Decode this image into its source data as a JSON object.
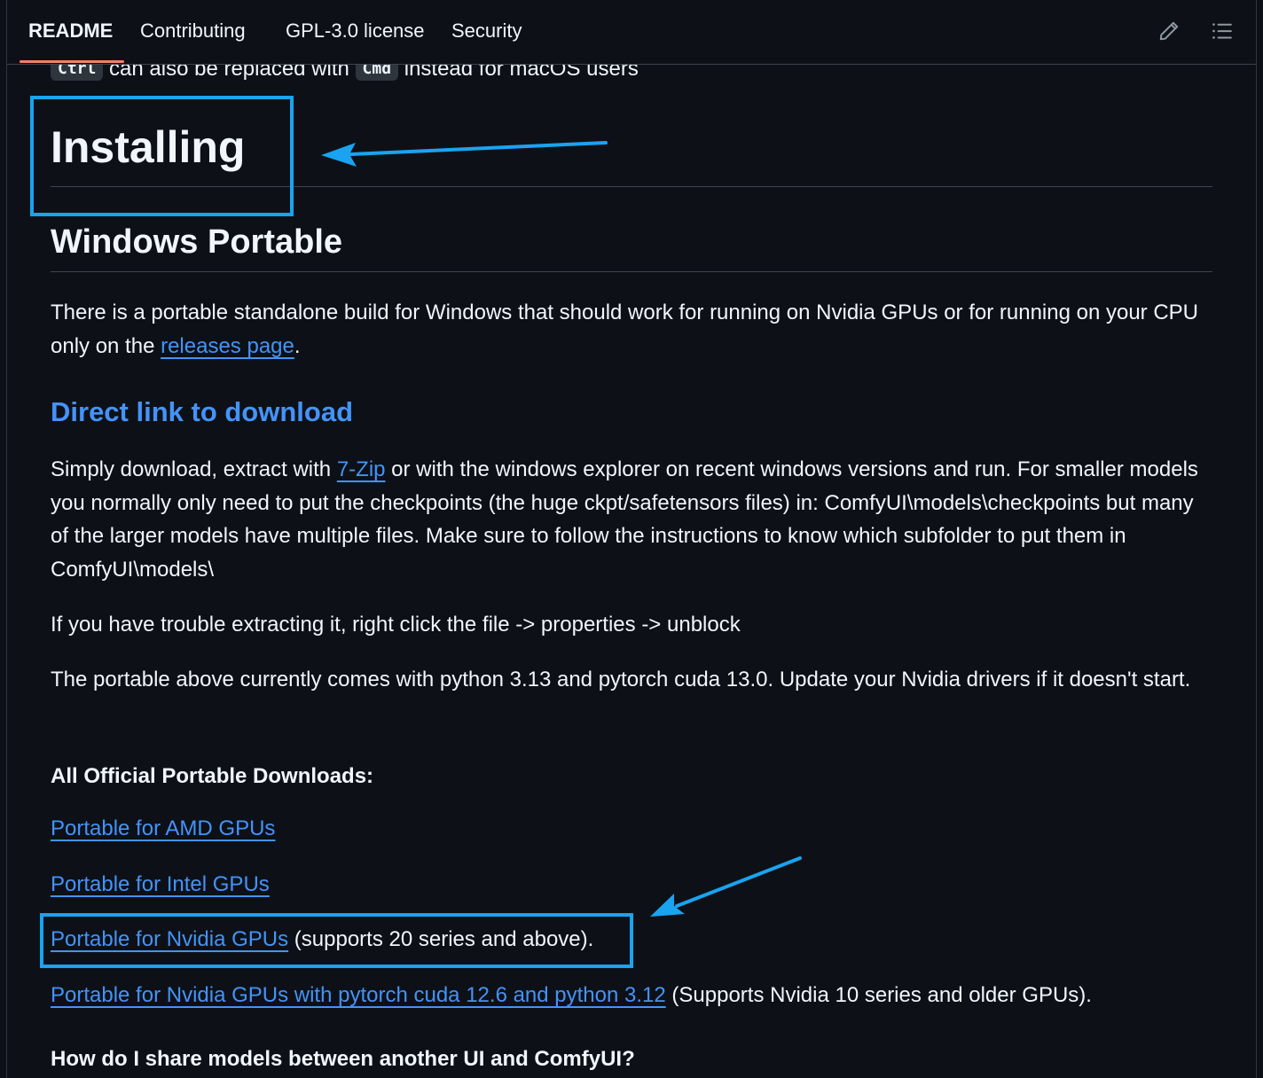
{
  "tabs": {
    "readme": "README",
    "contributing": "Contributing",
    "license": "GPL-3.0 license",
    "security": "Security"
  },
  "icons": {
    "edit": "pencil-icon",
    "outline": "list-icon"
  },
  "shortcut_note": {
    "key1": "Ctrl",
    "text1": "can also be replaced with",
    "key2": "Cmd",
    "text2": "instead for macOS users"
  },
  "headings": {
    "installing": "Installing",
    "windows_portable": "Windows Portable",
    "direct_link": "Direct link to download",
    "all_downloads": "All Official Portable Downloads:",
    "share_models": "How do I share models between another UI and ComfyUI?"
  },
  "intro": {
    "text1": "There is a portable standalone build for Windows that should work for running on Nvidia GPUs or for running on your CPU only on the ",
    "link": "releases page",
    "text2": "."
  },
  "simply": {
    "text1": "Simply download, extract with ",
    "link": "7-Zip",
    "text2": " or with the windows explorer on recent windows versions and run. For smaller models you normally only need to put the checkpoints (the huge ckpt/safetensors files) in: ComfyUI\\models\\checkpoints but many of the larger models have multiple files. Make sure to follow the instructions to know which subfolder to put them in ComfyUI\\models\\"
  },
  "trouble": "If you have trouble extracting it, right click the file -> properties -> unblock",
  "python_note": "The portable above currently comes with python 3.13 and pytorch cuda 13.0. Update your Nvidia drivers if it doesn't start.",
  "downloads": {
    "amd": "Portable for AMD GPUs",
    "intel": "Portable for Intel GPUs",
    "nvidia": "Portable for Nvidia GPUs",
    "nvidia_note": " (supports 20 series and above).",
    "nvidia_legacy": "Portable for Nvidia GPUs with pytorch cuda 12.6 and python 3.12",
    "nvidia_legacy_note": " (Supports Nvidia 10 series and older GPUs)."
  },
  "colors": {
    "background": "#0d1117",
    "text": "#f0f6fc",
    "link": "#4493f8",
    "active_tab_underline": "#f78166",
    "annotation": "#1aa3f0"
  }
}
